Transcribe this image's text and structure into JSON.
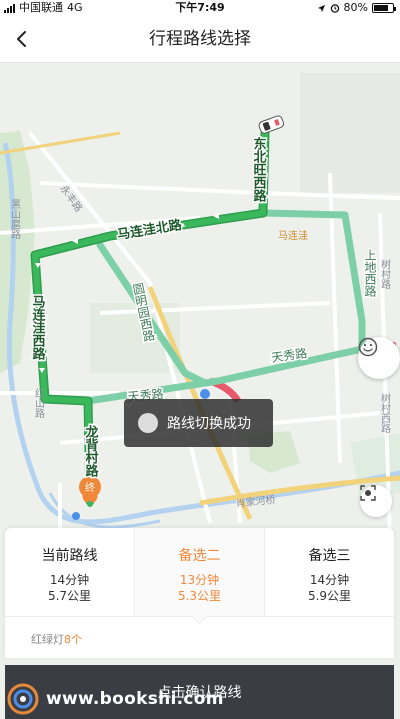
{
  "status_bar": {
    "carrier": "中国联通",
    "network": "4G",
    "time": "下午7:49",
    "battery": "80%",
    "battery_level": 0.8
  },
  "nav": {
    "back_icon": "chevron-left-icon",
    "title": "行程路线选择"
  },
  "map": {
    "road_labels": [
      "永丰路",
      "黑山扈路",
      "红山路",
      "马连洼",
      "树村路",
      "树村西路",
      "肖家河桥"
    ],
    "route_labels": [
      "东北旺西路",
      "马连洼北路",
      "马连洼西路",
      "龙背村路"
    ],
    "alt_route_labels": [
      "圆明园西路",
      "天秀路",
      "天秀路",
      "上地西路",
      "树村路"
    ],
    "start_marker": "终",
    "route_color": "#3bb85c",
    "alt_route_color": "#7ccfa6"
  },
  "toast": {
    "icon": "check-circle-icon",
    "text": "路线切换成功"
  },
  "route_panel": {
    "options": [
      {
        "name": "当前路线",
        "time": "14分钟",
        "distance": "5.7公里",
        "selected": false
      },
      {
        "name": "备选二",
        "time": "13分钟",
        "distance": "5.3公里",
        "selected": true
      },
      {
        "name": "备选三",
        "time": "14分钟",
        "distance": "5.9公里",
        "selected": false
      }
    ],
    "traffic_light_label": "红绿灯",
    "traffic_light_count": "8个",
    "accent_color": "#f08a3c"
  },
  "confirm_button": {
    "label": "点击确认路线"
  },
  "watermark": {
    "text": "www.bookshi.com"
  }
}
